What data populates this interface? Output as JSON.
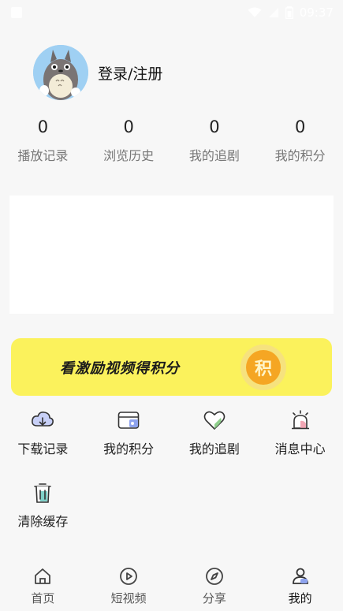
{
  "status_bar": {
    "time": "09:37"
  },
  "profile": {
    "login_label": "登录/注册"
  },
  "stats": [
    {
      "value": "0",
      "label": "播放记录"
    },
    {
      "value": "0",
      "label": "浏览历史"
    },
    {
      "value": "0",
      "label": "我的追剧"
    },
    {
      "value": "0",
      "label": "我的积分"
    }
  ],
  "banner": {
    "text": "看激励视频得积分",
    "coin_char": "积"
  },
  "menu": [
    {
      "label": "下载记录",
      "icon": "cloud-download-icon"
    },
    {
      "label": "我的积分",
      "icon": "card-icon"
    },
    {
      "label": "我的追剧",
      "icon": "heart-icon"
    },
    {
      "label": "消息中心",
      "icon": "alarm-icon"
    },
    {
      "label": "清除缓存",
      "icon": "trash-icon"
    }
  ],
  "nav": [
    {
      "label": "首页",
      "icon": "home-icon"
    },
    {
      "label": "短视频",
      "icon": "play-icon"
    },
    {
      "label": "分享",
      "icon": "compass-icon"
    },
    {
      "label": "我的",
      "icon": "user-icon",
      "active": true
    }
  ],
  "colors": {
    "banner": "#fbf25c",
    "coin": "#f5a623",
    "background": "#f7f7f7"
  }
}
